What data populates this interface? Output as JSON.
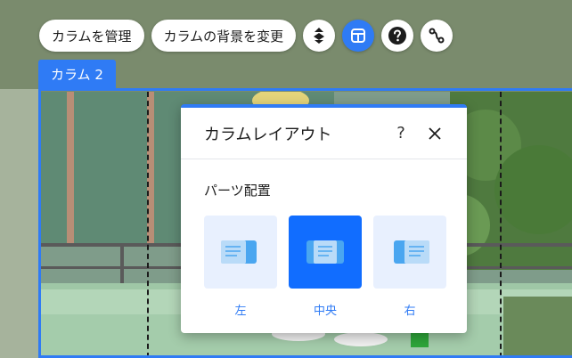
{
  "toolbar": {
    "manage_columns": "カラムを管理",
    "change_background": "カラムの背景を変更",
    "icons": [
      "arrange-icon",
      "layout-icon",
      "help-icon",
      "connect-icon"
    ]
  },
  "column_tab": {
    "label": "カラム 2"
  },
  "panel": {
    "title": "カラムレイアウト",
    "help": "?",
    "section_label": "パーツ配置",
    "options": [
      {
        "label": "左",
        "selected": false
      },
      {
        "label": "中央",
        "selected": true
      },
      {
        "label": "右",
        "selected": false
      }
    ]
  },
  "colors": {
    "accent": "#2f7bf5",
    "selected_option": "#116dff",
    "option_bg": "#e8f0fe"
  }
}
